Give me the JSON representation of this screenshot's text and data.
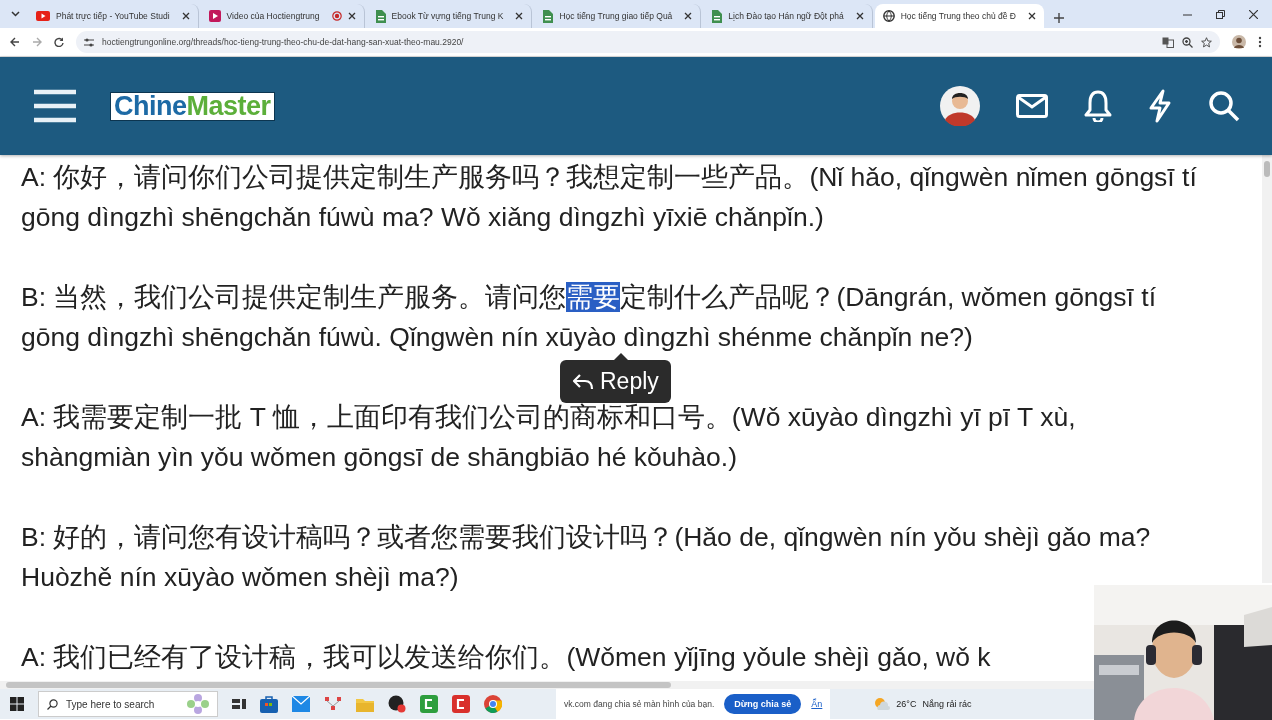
{
  "browser": {
    "tabs": [
      {
        "title": "Phát trực tiếp - YouTube Studi",
        "kind": "youtube",
        "recording": false,
        "selected": false
      },
      {
        "title": "Video của Hoctiengtrung",
        "kind": "video",
        "recording": true,
        "selected": false
      },
      {
        "title": "Ebook Từ vựng tiếng Trung K",
        "kind": "sheet",
        "recording": false,
        "selected": false
      },
      {
        "title": "Học tiếng Trung giao tiếp Quả",
        "kind": "sheet",
        "recording": false,
        "selected": false
      },
      {
        "title": "Lịch Đào tạo Hán ngữ Đột phá",
        "kind": "sheet",
        "recording": false,
        "selected": false
      },
      {
        "title": "Học tiếng Trung theo chủ đề Đ",
        "kind": "globe",
        "recording": false,
        "selected": true
      }
    ],
    "address": "hoctiengtrungonline.org/threads/hoc-tieng-trung-theo-chu-de-dat-hang-san-xuat-theo-mau.2920/"
  },
  "site": {
    "logo": [
      {
        "text": "Chine",
        "color": "#1d6aa5"
      },
      {
        "text": "Master",
        "color": "#5caf3a"
      }
    ]
  },
  "dialogue": [
    {
      "segments": [
        {
          "text": "A: 你好，请问你们公司提供定制生产服务吗？我想定制一些产品。(Nǐ hǎo, qǐngwèn nǐmen gōngsī tí gōng dìngzhì shēngchǎn fúwù ma? Wǒ xiǎng dìngzhì yīxiē chǎnpǐn.)",
          "selected": false
        }
      ]
    },
    {
      "segments": [
        {
          "text": "B: 当然，我们公司提供定制生产服务。请问您",
          "selected": false
        },
        {
          "text": "需要",
          "selected": true
        },
        {
          "text": "定制什么产品呢？(Dāngrán, wǒmen gōngsī tí gōng dìngzhì shēngchǎn fúwù. Qǐngwèn nín xūyào dìngzhì shénme chǎnpǐn ne?)",
          "selected": false
        }
      ]
    },
    {
      "segments": [
        {
          "text": "A: 我需要定制一批 T 恤，上面印有我们公司的商标和口号。(Wǒ xūyào dìngzhì yī pī T xù, shàngmiàn yìn yǒu wǒmen gōngsī de shāngbiāo hé kǒuhào.)",
          "selected": false
        }
      ]
    },
    {
      "segments": [
        {
          "text": "B: 好的，请问您有设计稿吗？或者您需要我们设计吗？(Hǎo de, qǐngwèn nín yǒu shèjì gǎo ma? Huòzhě nín xūyào wǒmen shèjì ma?)",
          "selected": false
        }
      ]
    },
    {
      "segments": [
        {
          "text": "A: 我们已经有了设计稿，我可以发送给你们。(Wǒmen yǐjīng yǒule shèjì gǎo, wǒ k",
          "selected": false
        }
      ]
    }
  ],
  "tooltip": {
    "label": "Reply"
  },
  "taskbar": {
    "search_placeholder": "Type here to search",
    "share_notice": "vk.com đang chia sẻ màn hình của bạn.",
    "stop_button": "Dừng chia sẻ",
    "hide_link": "Ẩn",
    "temperature": "26°C",
    "weather": "Nắng rải rác"
  }
}
